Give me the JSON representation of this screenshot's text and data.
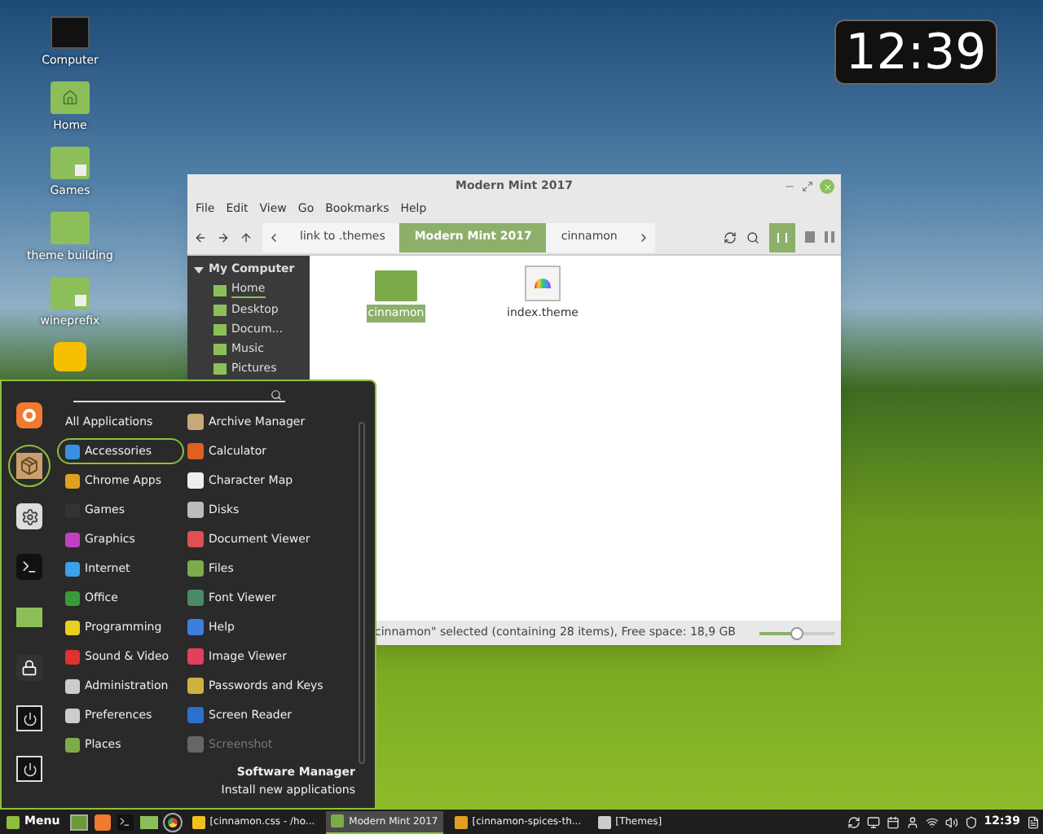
{
  "desktop_icons": [
    {
      "label": "Computer",
      "kind": "monitor"
    },
    {
      "label": "Home",
      "kind": "home"
    },
    {
      "label": "Games",
      "kind": "link"
    },
    {
      "label": "theme building",
      "kind": "folder"
    },
    {
      "label": "wineprefix",
      "kind": "link"
    },
    {
      "kind": "app"
    }
  ],
  "clock": "12:39",
  "window": {
    "title": "Modern Mint 2017",
    "menu": [
      "File",
      "Edit",
      "View",
      "Go",
      "Bookmarks",
      "Help"
    ],
    "breadcrumbs": [
      {
        "label": "link to .themes",
        "selected": false
      },
      {
        "label": "Modern Mint 2017",
        "selected": true
      },
      {
        "label": "cinnamon",
        "selected": false
      }
    ],
    "sidebar": {
      "heading": "My Computer",
      "items": [
        {
          "label": "Home",
          "selected": true
        },
        {
          "label": "Desktop",
          "selected": false
        },
        {
          "label": "Docum...",
          "selected": false
        },
        {
          "label": "Music",
          "selected": false
        },
        {
          "label": "Pictures",
          "selected": false
        }
      ]
    },
    "files": [
      {
        "name": "cinnamon",
        "kind": "folder",
        "selected": true
      },
      {
        "name": "index.theme",
        "kind": "theme",
        "selected": false
      }
    ],
    "status": "cinnamon\" selected (containing 28 items), Free space: 18,9 GB",
    "zoom": {
      "level": 0.5
    }
  },
  "menu": {
    "favorites": [
      {
        "kind": "firefox",
        "selected": false
      },
      {
        "kind": "package",
        "selected": true
      },
      {
        "kind": "settings",
        "selected": false
      },
      {
        "kind": "terminal",
        "selected": false
      },
      {
        "kind": "folder",
        "selected": false
      },
      {
        "kind": "lock",
        "selected": false
      },
      {
        "kind": "power",
        "selected": false
      },
      {
        "kind": "power",
        "selected": false
      }
    ],
    "categories": [
      {
        "label": "All Applications",
        "selected": false
      },
      {
        "label": "Accessories",
        "selected": true,
        "color": "#3b8fe0"
      },
      {
        "label": "Chrome Apps",
        "selected": false,
        "color": "#e0a020"
      },
      {
        "label": "Games",
        "selected": false,
        "color": "#333333"
      },
      {
        "label": "Graphics",
        "selected": false,
        "color": "#c040c0"
      },
      {
        "label": "Internet",
        "selected": false,
        "color": "#3aa0e8"
      },
      {
        "label": "Office",
        "selected": false,
        "color": "#3a9a3a"
      },
      {
        "label": "Programming",
        "selected": false,
        "color": "#e8d020"
      },
      {
        "label": "Sound & Video",
        "selected": false,
        "color": "#e03030"
      },
      {
        "label": "Administration",
        "selected": false,
        "color": "#cccccc"
      },
      {
        "label": "Preferences",
        "selected": false,
        "color": "#cccccc"
      },
      {
        "label": "Places",
        "selected": false,
        "color": "#7cab4a"
      }
    ],
    "apps": [
      {
        "label": "Archive Manager",
        "disabled": false,
        "color": "#c8a878"
      },
      {
        "label": "Calculator",
        "disabled": false,
        "color": "#e06020"
      },
      {
        "label": "Character Map",
        "disabled": false,
        "color": "#eeeeee"
      },
      {
        "label": "Disks",
        "disabled": false,
        "color": "#bbbbbb"
      },
      {
        "label": "Document Viewer",
        "disabled": false,
        "color": "#e05050"
      },
      {
        "label": "Files",
        "disabled": false,
        "color": "#7cab4a"
      },
      {
        "label": "Font Viewer",
        "disabled": false,
        "color": "#4a8a6a"
      },
      {
        "label": "Help",
        "disabled": false,
        "color": "#3b7fe0"
      },
      {
        "label": "Image Viewer",
        "disabled": false,
        "color": "#e04060"
      },
      {
        "label": "Passwords and Keys",
        "disabled": false,
        "color": "#d0b040"
      },
      {
        "label": "Screen Reader",
        "disabled": false,
        "color": "#2a70d0"
      },
      {
        "label": "Screenshot",
        "disabled": true,
        "color": "#666666"
      }
    ],
    "footer": {
      "title": "Software Manager",
      "subtitle": "Install new applications"
    }
  },
  "taskbar": {
    "menu_label": "Menu",
    "launchers": [
      {
        "kind": "desktop"
      },
      {
        "kind": "firefox"
      },
      {
        "kind": "terminal"
      },
      {
        "kind": "folder"
      },
      {
        "kind": "chrome"
      }
    ],
    "windows": [
      {
        "label": "[cinnamon.css - /ho...",
        "selected": false,
        "color": "#f0c020"
      },
      {
        "label": "Modern Mint 2017",
        "selected": true,
        "color": "#7cab4a"
      },
      {
        "label": "[cinnamon-spices-th...",
        "selected": false,
        "color": "#e0a020"
      },
      {
        "label": "[Themes]",
        "selected": false,
        "color": "#cccccc"
      }
    ],
    "time": "12:39"
  }
}
